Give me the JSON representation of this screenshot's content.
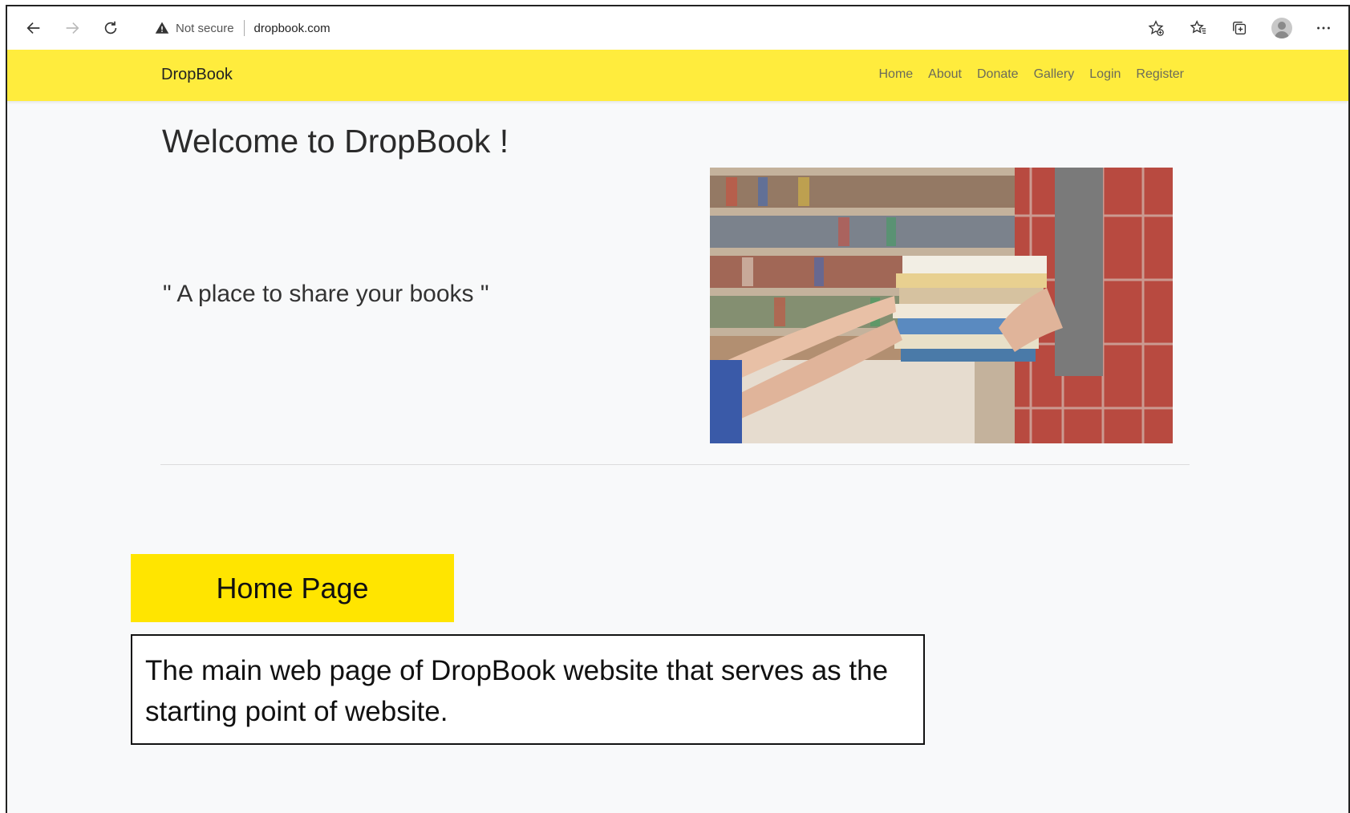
{
  "browser": {
    "security_label": "Not secure",
    "url": "dropbook.com"
  },
  "site": {
    "brand": "DropBook",
    "nav": [
      {
        "label": "Home"
      },
      {
        "label": "About"
      },
      {
        "label": "Donate"
      },
      {
        "label": "Gallery"
      },
      {
        "label": "Login"
      },
      {
        "label": "Register"
      }
    ],
    "welcome_title": "Welcome to DropBook !",
    "tagline": "\" A place to share your books \""
  },
  "annotation": {
    "label": "Home Page",
    "description": "The main web page of DropBook website that serves as the starting point of website."
  },
  "colors": {
    "navbar": "#ffec3d",
    "label_box": "#ffe500",
    "page_bg": "#f8f9fa"
  }
}
